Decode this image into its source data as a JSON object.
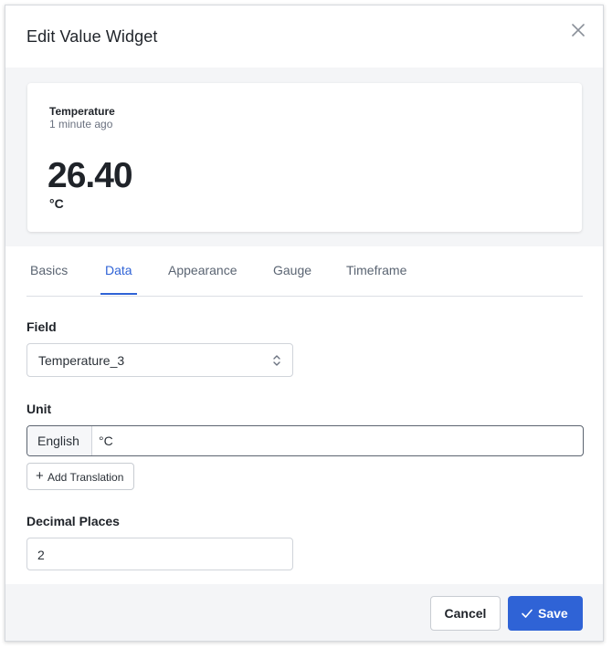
{
  "dialog": {
    "title": "Edit Value Widget"
  },
  "preview": {
    "title": "Temperature",
    "subtitle": "1 minute ago",
    "value": "26.40",
    "unit": "°C"
  },
  "tabs": [
    {
      "label": "Basics",
      "active": false
    },
    {
      "label": "Data",
      "active": true
    },
    {
      "label": "Appearance",
      "active": false
    },
    {
      "label": "Gauge",
      "active": false
    },
    {
      "label": "Timeframe",
      "active": false
    }
  ],
  "form": {
    "field_label": "Field",
    "field_value": "Temperature_3",
    "unit_label": "Unit",
    "unit_language": "English",
    "unit_value": "°C",
    "add_translation_label": "Add Translation",
    "decimal_label": "Decimal Places",
    "decimal_value": "2"
  },
  "footer": {
    "cancel_label": "Cancel",
    "save_label": "Save"
  },
  "colors": {
    "accent": "#2f63d6",
    "panel_bg": "#f4f5f7"
  },
  "icons": {
    "close": "close-icon",
    "select": "chevron-up-down-icon",
    "add": "plus-icon",
    "save": "check-icon"
  }
}
